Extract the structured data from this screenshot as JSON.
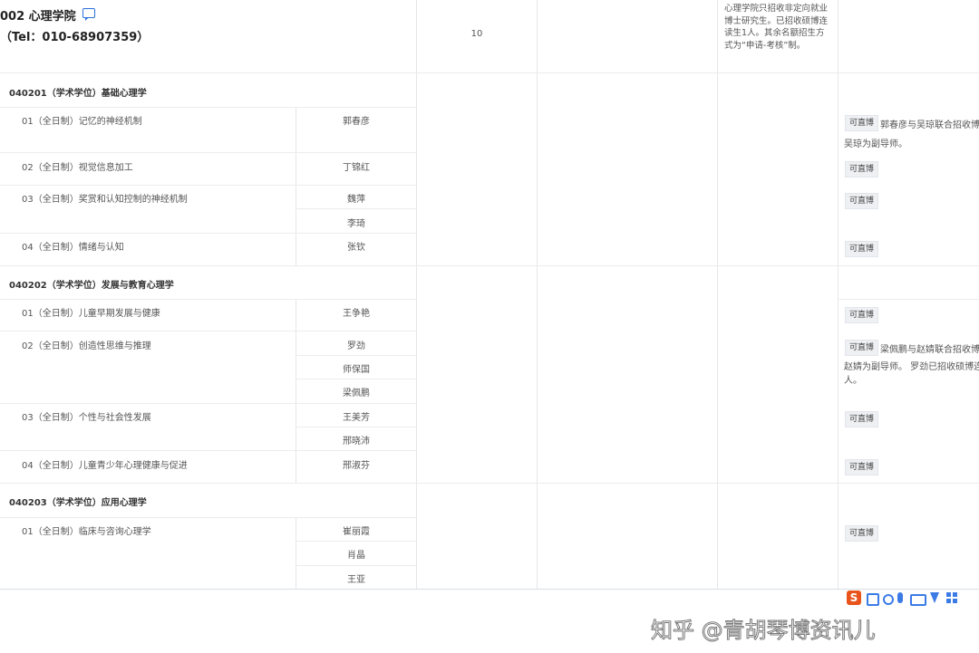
{
  "header": {
    "dept_title": "002 心理学院",
    "tel": "（Tel：010-68907359）",
    "count": "10",
    "remark_lines": [
      "心理学院只招收非定向就业",
      "博士研究生。已招收硕博连",
      "读生1人。其余名额招生方",
      "式为“申请-考核”制。"
    ]
  },
  "majors": [
    {
      "title": "040201（学术学位）基础心理学"
    },
    {
      "title": "040202（学术学位）发展与教育心理学"
    },
    {
      "title": "040203（学术学位）应用心理学"
    }
  ],
  "directions": [
    {
      "name": "01（全日制）记忆的神经机制",
      "supervisors": [
        "郭春彦"
      ]
    },
    {
      "name": "02（全日制）视觉信息加工",
      "supervisors": [
        "丁锦红"
      ]
    },
    {
      "name": "03（全日制）奖赏和认知控制的神经机制",
      "supervisors": [
        "魏萍",
        "李琦"
      ]
    },
    {
      "name": "04（全日制）情绪与认知",
      "supervisors": [
        "张钦"
      ]
    },
    {
      "name": "01（全日制）儿童早期发展与健康",
      "supervisors": [
        "王争艳"
      ]
    },
    {
      "name": "02（全日制）创造性思维与推理",
      "supervisors": [
        "罗劲",
        "师保国",
        "梁佩鹏"
      ]
    },
    {
      "name": "03（全日制）个性与社会性发展",
      "supervisors": [
        "王美芳",
        "邢晓沛"
      ]
    },
    {
      "name": "04（全日制）儿童青少年心理健康与促进",
      "supervisors": [
        "邢淑芬"
      ]
    },
    {
      "name": "01（全日制）临床与咨询心理学",
      "supervisors": [
        "崔丽霞",
        "肖晶",
        "王亚"
      ]
    }
  ],
  "tags": {
    "label": "可直博"
  },
  "notes": {
    "n1_line1": "郭春彦与吴琼联合招收博",
    "n1_line2": "吴琼为副导师。",
    "n6_line1": "梁佩鹏与赵婧联合招收博",
    "n6_line2": "赵婧为副导师。 罗劲已招收硕博连",
    "n6_line3": "人。"
  },
  "watermark": "知乎 @青胡琴博资讯儿",
  "colors": {
    "accent": "#2a6fdb",
    "border": "#e6e6e6",
    "tag_bg": "#eef0f3"
  },
  "icons": {
    "comment": "comment-icon",
    "toolbar": "ime-toolbar-icons"
  }
}
